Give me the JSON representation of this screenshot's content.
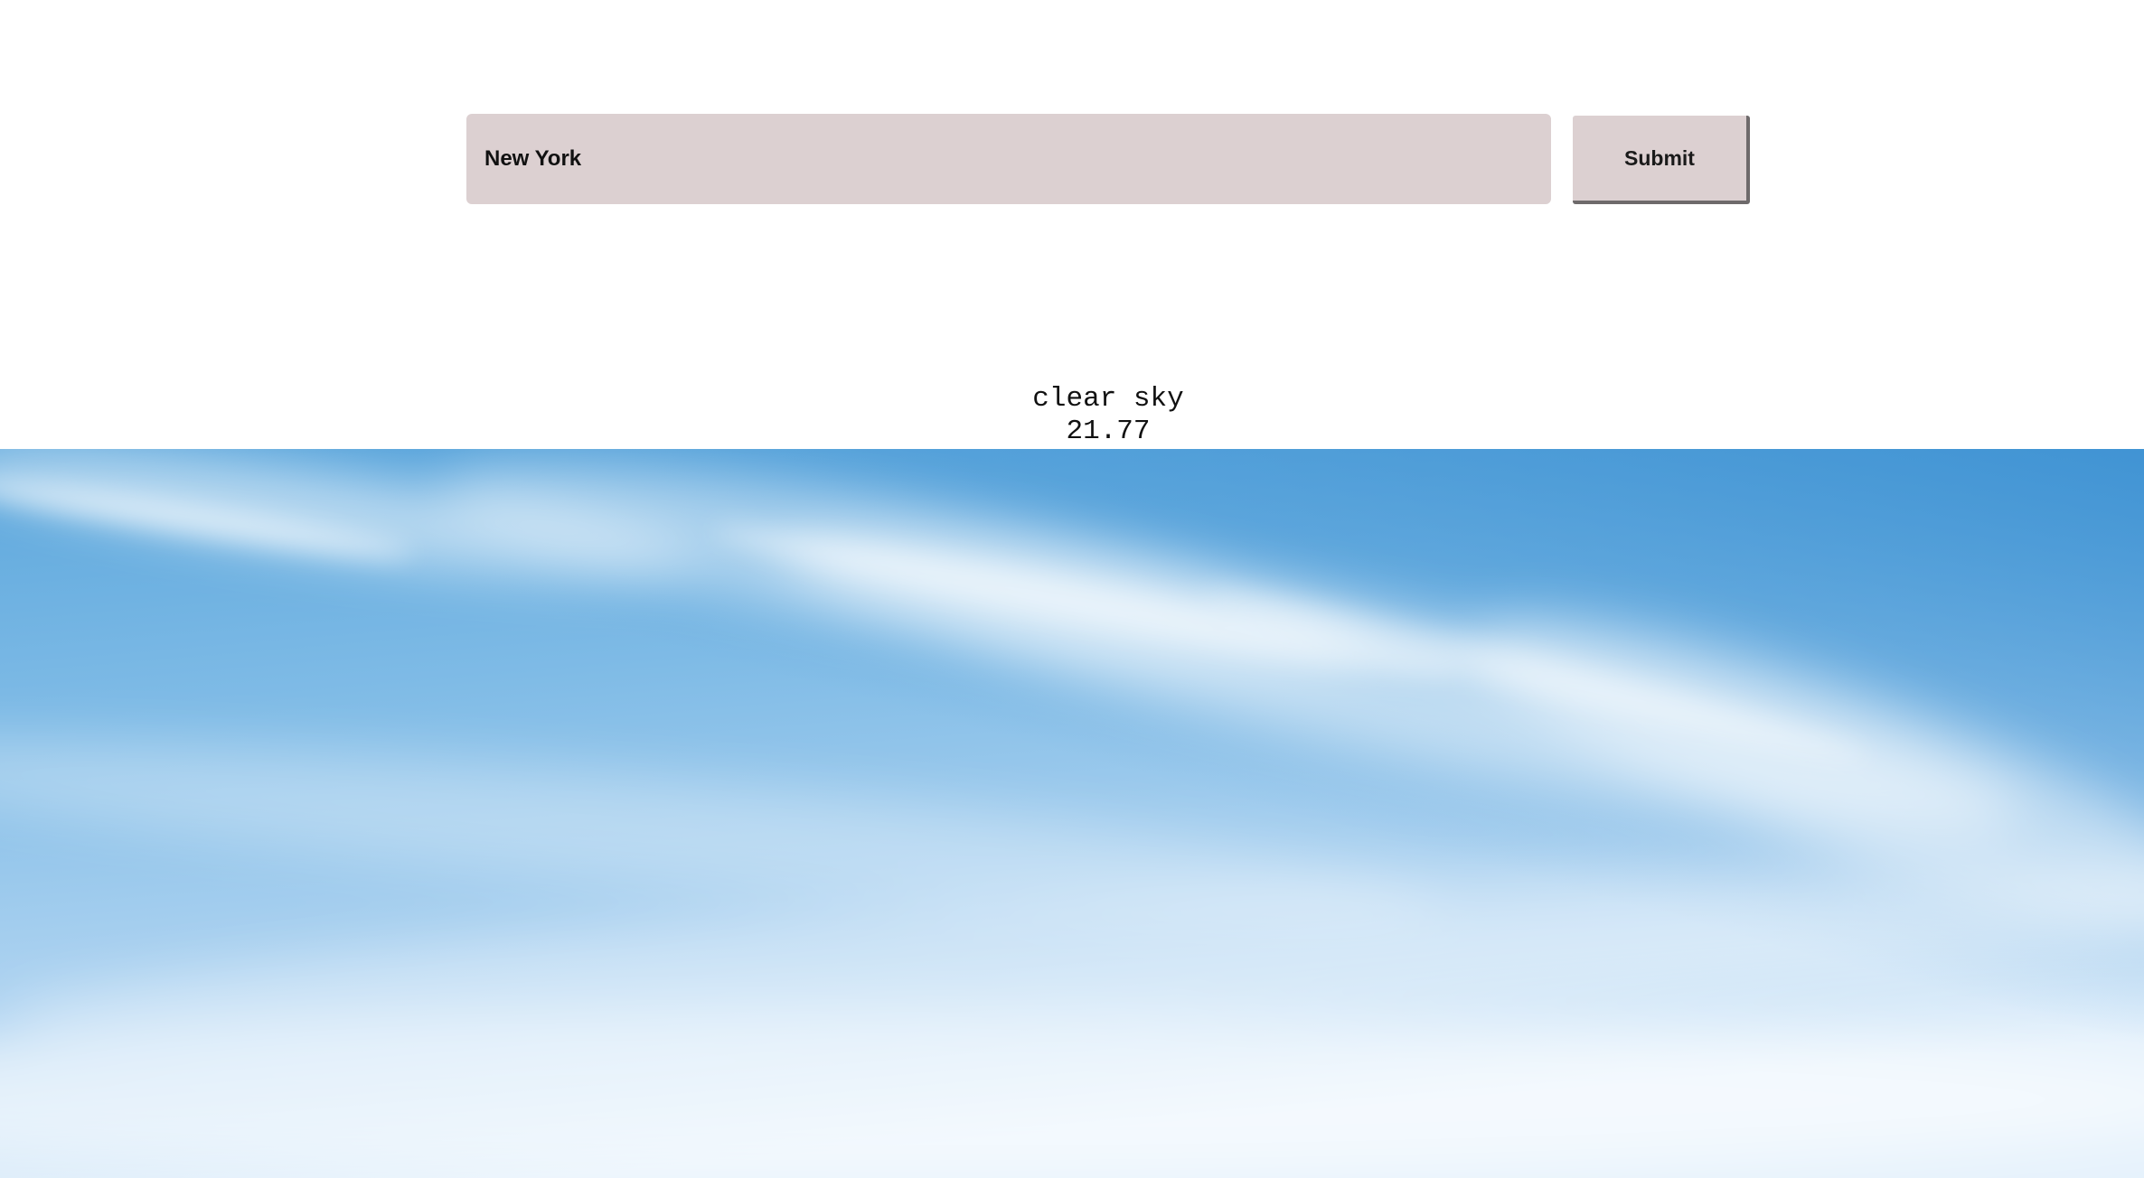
{
  "search": {
    "value": "New York",
    "submit_label": "Submit"
  },
  "weather": {
    "description": "clear sky",
    "temperature": "21.77"
  },
  "background": {
    "subject": "blue sky with wispy clouds",
    "colors": {
      "sky_deep": "#3e94d4",
      "sky_mid": "#7fbbe6",
      "sky_light": "#e6f2fc",
      "input_bg": "#dcd0d1",
      "button_shadow": "#6e6a6b"
    }
  }
}
